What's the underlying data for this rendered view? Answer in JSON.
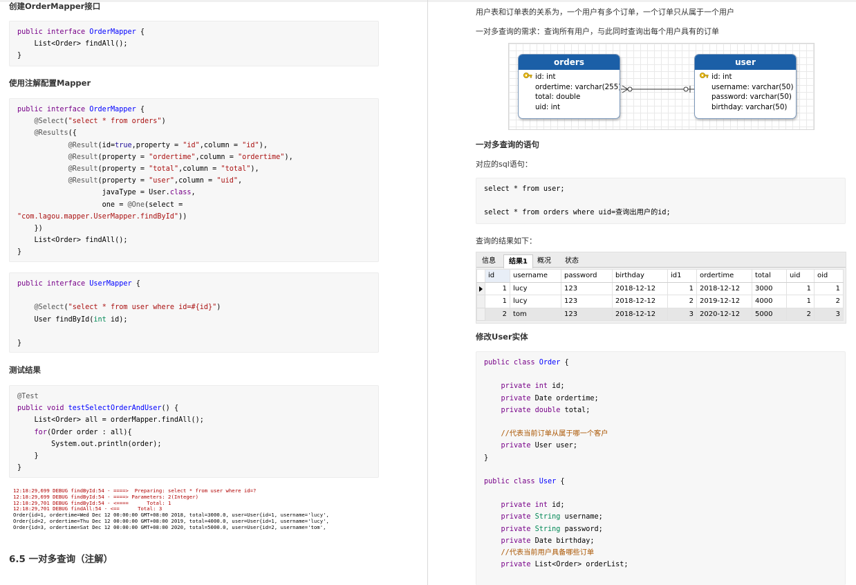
{
  "left": {
    "h_create_mapper": "创建OrderMapper接口",
    "code1": [
      [
        {
          "t": "public interface ",
          "c": "kw"
        },
        {
          "t": "OrderMapper",
          "c": "def"
        },
        {
          "t": " {",
          "c": ""
        }
      ],
      [
        {
          "t": "    List<Order> findAll();",
          "c": ""
        }
      ],
      [
        {
          "t": "}",
          "c": ""
        }
      ]
    ],
    "h_annotation_mapper": "使用注解配置Mapper",
    "code2": [
      [
        {
          "t": "public interface ",
          "c": "kw"
        },
        {
          "t": "OrderMapper",
          "c": "def"
        },
        {
          "t": " {",
          "c": ""
        }
      ],
      [
        {
          "t": "    ",
          "c": ""
        },
        {
          "t": "@Select",
          "c": "ann"
        },
        {
          "t": "(",
          "c": ""
        },
        {
          "t": "\"select * from orders\"",
          "c": "str"
        },
        {
          "t": ")",
          "c": ""
        }
      ],
      [
        {
          "t": "    ",
          "c": ""
        },
        {
          "t": "@Results",
          "c": "ann"
        },
        {
          "t": "({",
          "c": ""
        }
      ],
      [
        {
          "t": "            ",
          "c": ""
        },
        {
          "t": "@Result",
          "c": "ann"
        },
        {
          "t": "(id=",
          "c": ""
        },
        {
          "t": "true",
          "c": "atom"
        },
        {
          "t": ",property = ",
          "c": ""
        },
        {
          "t": "\"id\"",
          "c": "str"
        },
        {
          "t": ",column = ",
          "c": ""
        },
        {
          "t": "\"id\"",
          "c": "str"
        },
        {
          "t": "),",
          "c": ""
        }
      ],
      [
        {
          "t": "            ",
          "c": ""
        },
        {
          "t": "@Result",
          "c": "ann"
        },
        {
          "t": "(property = ",
          "c": ""
        },
        {
          "t": "\"ordertime\"",
          "c": "str"
        },
        {
          "t": ",column = ",
          "c": ""
        },
        {
          "t": "\"ordertime\"",
          "c": "str"
        },
        {
          "t": "),",
          "c": ""
        }
      ],
      [
        {
          "t": "            ",
          "c": ""
        },
        {
          "t": "@Result",
          "c": "ann"
        },
        {
          "t": "(property = ",
          "c": ""
        },
        {
          "t": "\"total\"",
          "c": "str"
        },
        {
          "t": ",column = ",
          "c": ""
        },
        {
          "t": "\"total\"",
          "c": "str"
        },
        {
          "t": "),",
          "c": ""
        }
      ],
      [
        {
          "t": "            ",
          "c": ""
        },
        {
          "t": "@Result",
          "c": "ann"
        },
        {
          "t": "(property = ",
          "c": ""
        },
        {
          "t": "\"user\"",
          "c": "str"
        },
        {
          "t": ",column = ",
          "c": ""
        },
        {
          "t": "\"uid\"",
          "c": "str"
        },
        {
          "t": ",",
          "c": ""
        }
      ],
      [
        {
          "t": "                    javaType = User.",
          "c": ""
        },
        {
          "t": "class",
          "c": "kw"
        },
        {
          "t": ",",
          "c": ""
        }
      ],
      [
        {
          "t": "                    one = ",
          "c": ""
        },
        {
          "t": "@One",
          "c": "ann"
        },
        {
          "t": "(select =",
          "c": ""
        }
      ],
      [
        {
          "t": "\"com.lagou.mapper.UserMapper.findById\"",
          "c": "str"
        },
        {
          "t": "))",
          "c": ""
        }
      ],
      [
        {
          "t": "    })",
          "c": ""
        }
      ],
      [
        {
          "t": "    List<Order> findAll();",
          "c": ""
        }
      ],
      [
        {
          "t": "}",
          "c": ""
        }
      ]
    ],
    "code3": [
      [
        {
          "t": "public interface ",
          "c": "kw"
        },
        {
          "t": "UserMapper",
          "c": "def"
        },
        {
          "t": " {",
          "c": ""
        }
      ],
      [
        {
          "t": "",
          "c": ""
        }
      ],
      [
        {
          "t": "    ",
          "c": ""
        },
        {
          "t": "@Select",
          "c": "ann"
        },
        {
          "t": "(",
          "c": ""
        },
        {
          "t": "\"select * from user where id=#{id}\"",
          "c": "str"
        },
        {
          "t": ")",
          "c": ""
        }
      ],
      [
        {
          "t": "    User findById(",
          "c": ""
        },
        {
          "t": "int",
          "c": "typ"
        },
        {
          "t": " id);",
          "c": ""
        }
      ],
      [
        {
          "t": "",
          "c": ""
        }
      ],
      [
        {
          "t": "}",
          "c": ""
        }
      ]
    ],
    "h_test_result": "测试结果",
    "code4": [
      [
        {
          "t": "@Test",
          "c": "ann"
        }
      ],
      [
        {
          "t": "public void ",
          "c": "kw"
        },
        {
          "t": "testSelectOrderAndUser",
          "c": "def"
        },
        {
          "t": "() {",
          "c": ""
        }
      ],
      [
        {
          "t": "    List<Order> all = orderMapper.findAll();",
          "c": ""
        }
      ],
      [
        {
          "t": "    ",
          "c": ""
        },
        {
          "t": "for",
          "c": "kw"
        },
        {
          "t": "(Order order : all){",
          "c": ""
        }
      ],
      [
        {
          "t": "        System.out.println(order);",
          "c": ""
        }
      ],
      [
        {
          "t": "    }",
          "c": ""
        }
      ],
      [
        {
          "t": "}",
          "c": ""
        }
      ]
    ],
    "log_red": [
      "12:18:29,699 DEBUG findById:54 - ====>  Preparing: select * from user where id=?",
      "12:18:29,699 DEBUG findById:54 - ====> Parameters: 2(Integer)",
      "12:18:29,701 DEBUG findById:54 - <====      Total: 1",
      "12:18:29,701 DEBUG findAll:54 - <==      Total: 3"
    ],
    "log_black": [
      "Order{id=1, ordertime=Wed Dec 12 00:00:00 GMT+08:00 2018, total=3000.0, user=User{id=1, username='lucy',",
      "Order{id=2, ordertime=Thu Dec 12 00:00:00 GMT+08:00 2019, total=4000.0, user=User{id=1, username='lucy',",
      "Order{id=3, ordertime=Sat Dec 12 00:00:00 GMT+08:00 2020, total=5000.0, user=User{id=2, username='tom',"
    ],
    "section_title": "6.5 一对多查询（注解）"
  },
  "right": {
    "p_relation": "用户表和订单表的关系为，一个用户有多个订单，一个订单只从属于一个用户",
    "p_requirement": "一对多查询的需求：查询所有用户，与此同时查询出每个用户具有的订单",
    "er": {
      "orders": {
        "title": "orders",
        "fields": [
          "id: int",
          "ordertime: varchar(255)",
          "total: double",
          "uid: int"
        ]
      },
      "user": {
        "title": "user",
        "fields": [
          "id: int",
          "username: varchar(50)",
          "password: varchar(50)",
          "birthday: varchar(50)"
        ]
      },
      "header_color": "#1b5fa7"
    },
    "h_statement": "一对多查询的语句",
    "p_sql": "对应的sql语句：",
    "sql_lines": [
      "select * from user;",
      "",
      "select * from orders where uid=查询出用户的id;"
    ],
    "p_result": "查询的结果如下：",
    "grid": {
      "tabs": [
        "信息",
        "结果1",
        "概况",
        "状态"
      ],
      "active_tab": 1,
      "columns": [
        "id",
        "username",
        "password",
        "birthday",
        "id1",
        "ordertime",
        "total",
        "uid",
        "oid"
      ],
      "rows": [
        [
          "1",
          "lucy",
          "123",
          "2018-12-12",
          "1",
          "2018-12-12",
          "3000",
          "1",
          "1"
        ],
        [
          "1",
          "lucy",
          "123",
          "2018-12-12",
          "2",
          "2019-12-12",
          "4000",
          "1",
          "2"
        ],
        [
          "2",
          "tom",
          "123",
          "2018-12-12",
          "3",
          "2020-12-12",
          "5000",
          "2",
          "3"
        ]
      ]
    },
    "h_modify_user": "修改User实体",
    "code5": [
      [
        {
          "t": "public class ",
          "c": "kw"
        },
        {
          "t": "Order",
          "c": "def"
        },
        {
          "t": " {",
          "c": ""
        }
      ],
      [
        {
          "t": "",
          "c": ""
        }
      ],
      [
        {
          "t": "    ",
          "c": ""
        },
        {
          "t": "private int",
          "c": "kw"
        },
        {
          "t": " id;",
          "c": ""
        }
      ],
      [
        {
          "t": "    ",
          "c": ""
        },
        {
          "t": "private",
          "c": "kw"
        },
        {
          "t": " Date ordertime;",
          "c": ""
        }
      ],
      [
        {
          "t": "    ",
          "c": ""
        },
        {
          "t": "private double",
          "c": "kw"
        },
        {
          "t": " total;",
          "c": ""
        }
      ],
      [
        {
          "t": "",
          "c": ""
        }
      ],
      [
        {
          "t": "    ",
          "c": ""
        },
        {
          "t": "//代表当前订单从属于哪一个客户",
          "c": "com"
        }
      ],
      [
        {
          "t": "    ",
          "c": ""
        },
        {
          "t": "private",
          "c": "kw"
        },
        {
          "t": " User user;",
          "c": ""
        }
      ],
      [
        {
          "t": "}",
          "c": ""
        }
      ],
      [
        {
          "t": "",
          "c": ""
        }
      ],
      [
        {
          "t": "public class ",
          "c": "kw"
        },
        {
          "t": "User",
          "c": "def"
        },
        {
          "t": " {",
          "c": ""
        }
      ],
      [
        {
          "t": "",
          "c": ""
        }
      ],
      [
        {
          "t": "    ",
          "c": ""
        },
        {
          "t": "private int",
          "c": "kw"
        },
        {
          "t": " id;",
          "c": ""
        }
      ],
      [
        {
          "t": "    ",
          "c": ""
        },
        {
          "t": "private",
          "c": "kw"
        },
        {
          "t": " ",
          "c": ""
        },
        {
          "t": "String",
          "c": "typ"
        },
        {
          "t": " username;",
          "c": ""
        }
      ],
      [
        {
          "t": "    ",
          "c": ""
        },
        {
          "t": "private",
          "c": "kw"
        },
        {
          "t": " ",
          "c": ""
        },
        {
          "t": "String",
          "c": "typ"
        },
        {
          "t": " password;",
          "c": ""
        }
      ],
      [
        {
          "t": "    ",
          "c": ""
        },
        {
          "t": "private",
          "c": "kw"
        },
        {
          "t": " Date birthday;",
          "c": ""
        }
      ],
      [
        {
          "t": "    ",
          "c": ""
        },
        {
          "t": "//代表当前用户具备哪些订单",
          "c": "com"
        }
      ],
      [
        {
          "t": "    ",
          "c": ""
        },
        {
          "t": "private",
          "c": "kw"
        },
        {
          "t": " List<Order> orderList;",
          "c": ""
        }
      ]
    ]
  }
}
